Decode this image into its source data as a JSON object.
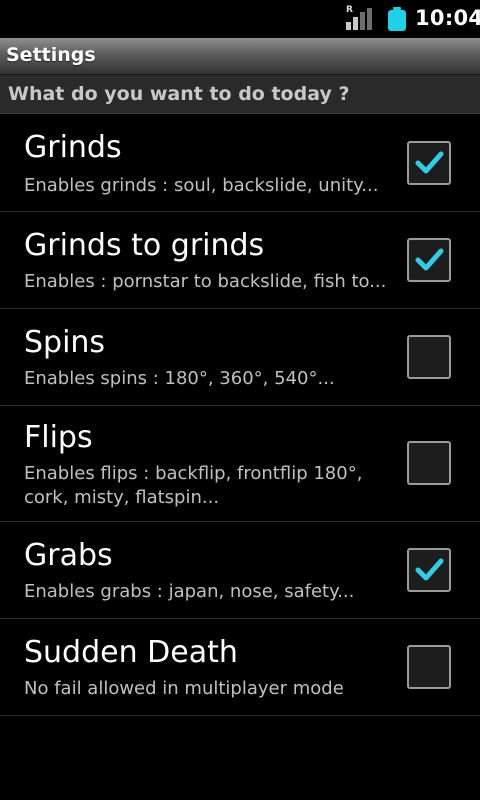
{
  "status_bar": {
    "signal_badge": "R",
    "time": "10:04",
    "battery_color": "#20d0e6"
  },
  "app": {
    "title": "Settings"
  },
  "category": {
    "label": "What do you want to do today ?"
  },
  "accent_color": "#33cce6",
  "preferences": [
    {
      "title": "Grinds",
      "summary": "Enables grinds : soul, backslide, unity...",
      "checked": true
    },
    {
      "title": "Grinds to grinds",
      "summary": "Enables : pornstar to backslide, fish to...",
      "checked": true
    },
    {
      "title": "Spins",
      "summary": "Enables spins : 180°, 360°, 540°...",
      "checked": false
    },
    {
      "title": "Flips",
      "summary": "Enables flips : backflip, frontflip 180°, cork, misty, flatspin...",
      "checked": false
    },
    {
      "title": "Grabs",
      "summary": "Enables grabs : japan, nose, safety...",
      "checked": true
    },
    {
      "title": "Sudden Death",
      "summary": "No fail allowed in multiplayer mode",
      "checked": false
    }
  ]
}
